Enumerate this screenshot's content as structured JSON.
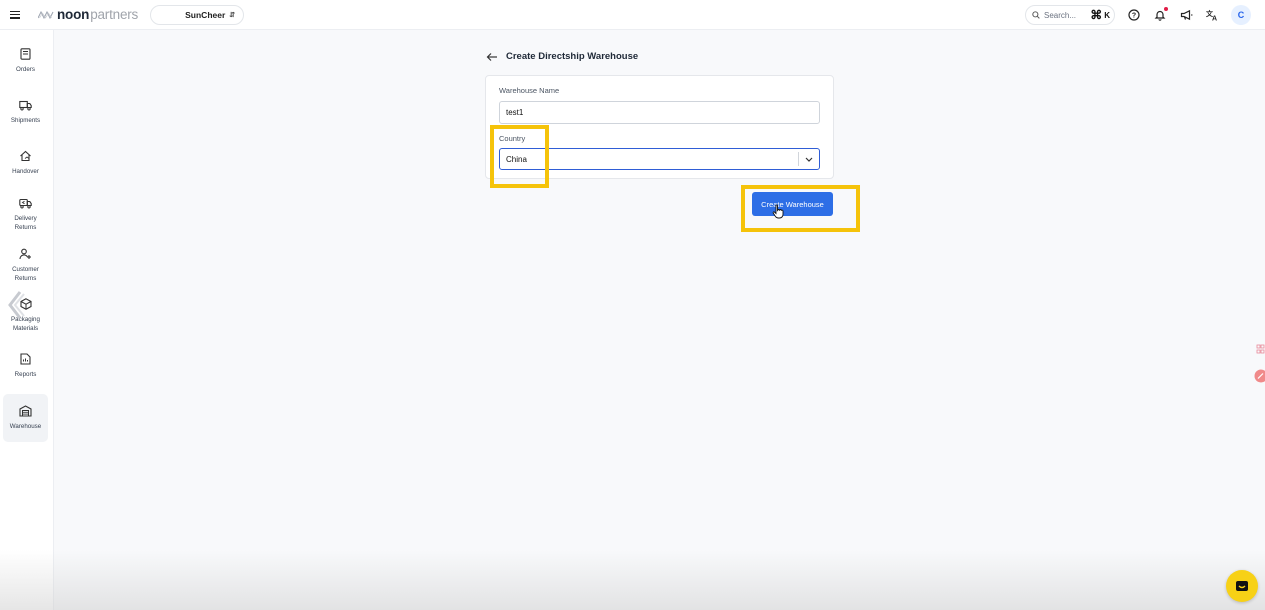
{
  "app": {
    "brand_bold": "noon",
    "brand_light": "partners"
  },
  "header": {
    "store_name": "SunCheer",
    "search_placeholder": "Search...",
    "shortcut_key": "K",
    "avatar_letter": "C"
  },
  "sidebar": {
    "items": [
      {
        "label_lines": [
          "Orders"
        ],
        "icon": "orders-icon"
      },
      {
        "label_lines": [
          "Shipments"
        ],
        "icon": "truck-icon"
      },
      {
        "label_lines": [
          "Handover"
        ],
        "icon": "handover-home-icon"
      },
      {
        "label_lines": [
          "Delivery",
          "Returns"
        ],
        "icon": "delivery-return-icon"
      },
      {
        "label_lines": [
          "Customer",
          "Returns"
        ],
        "icon": "customer-return-icon"
      },
      {
        "label_lines": [
          "Packaging",
          "Materials"
        ],
        "icon": "package-icon"
      },
      {
        "label_lines": [
          "Reports"
        ],
        "icon": "report-icon"
      },
      {
        "label_lines": [
          "Warehouse"
        ],
        "icon": "warehouse-icon",
        "active": true
      }
    ]
  },
  "page": {
    "title": "Create Directship Warehouse"
  },
  "form": {
    "warehouse_name_label": "Warehouse Name",
    "warehouse_name_value": "test1",
    "country_label": "Country",
    "country_value": "China",
    "submit_label": "Create Warehouse"
  },
  "colors": {
    "primary": "#2d6ee6",
    "highlight": "#f5c30a",
    "chat": "#f7d116"
  }
}
